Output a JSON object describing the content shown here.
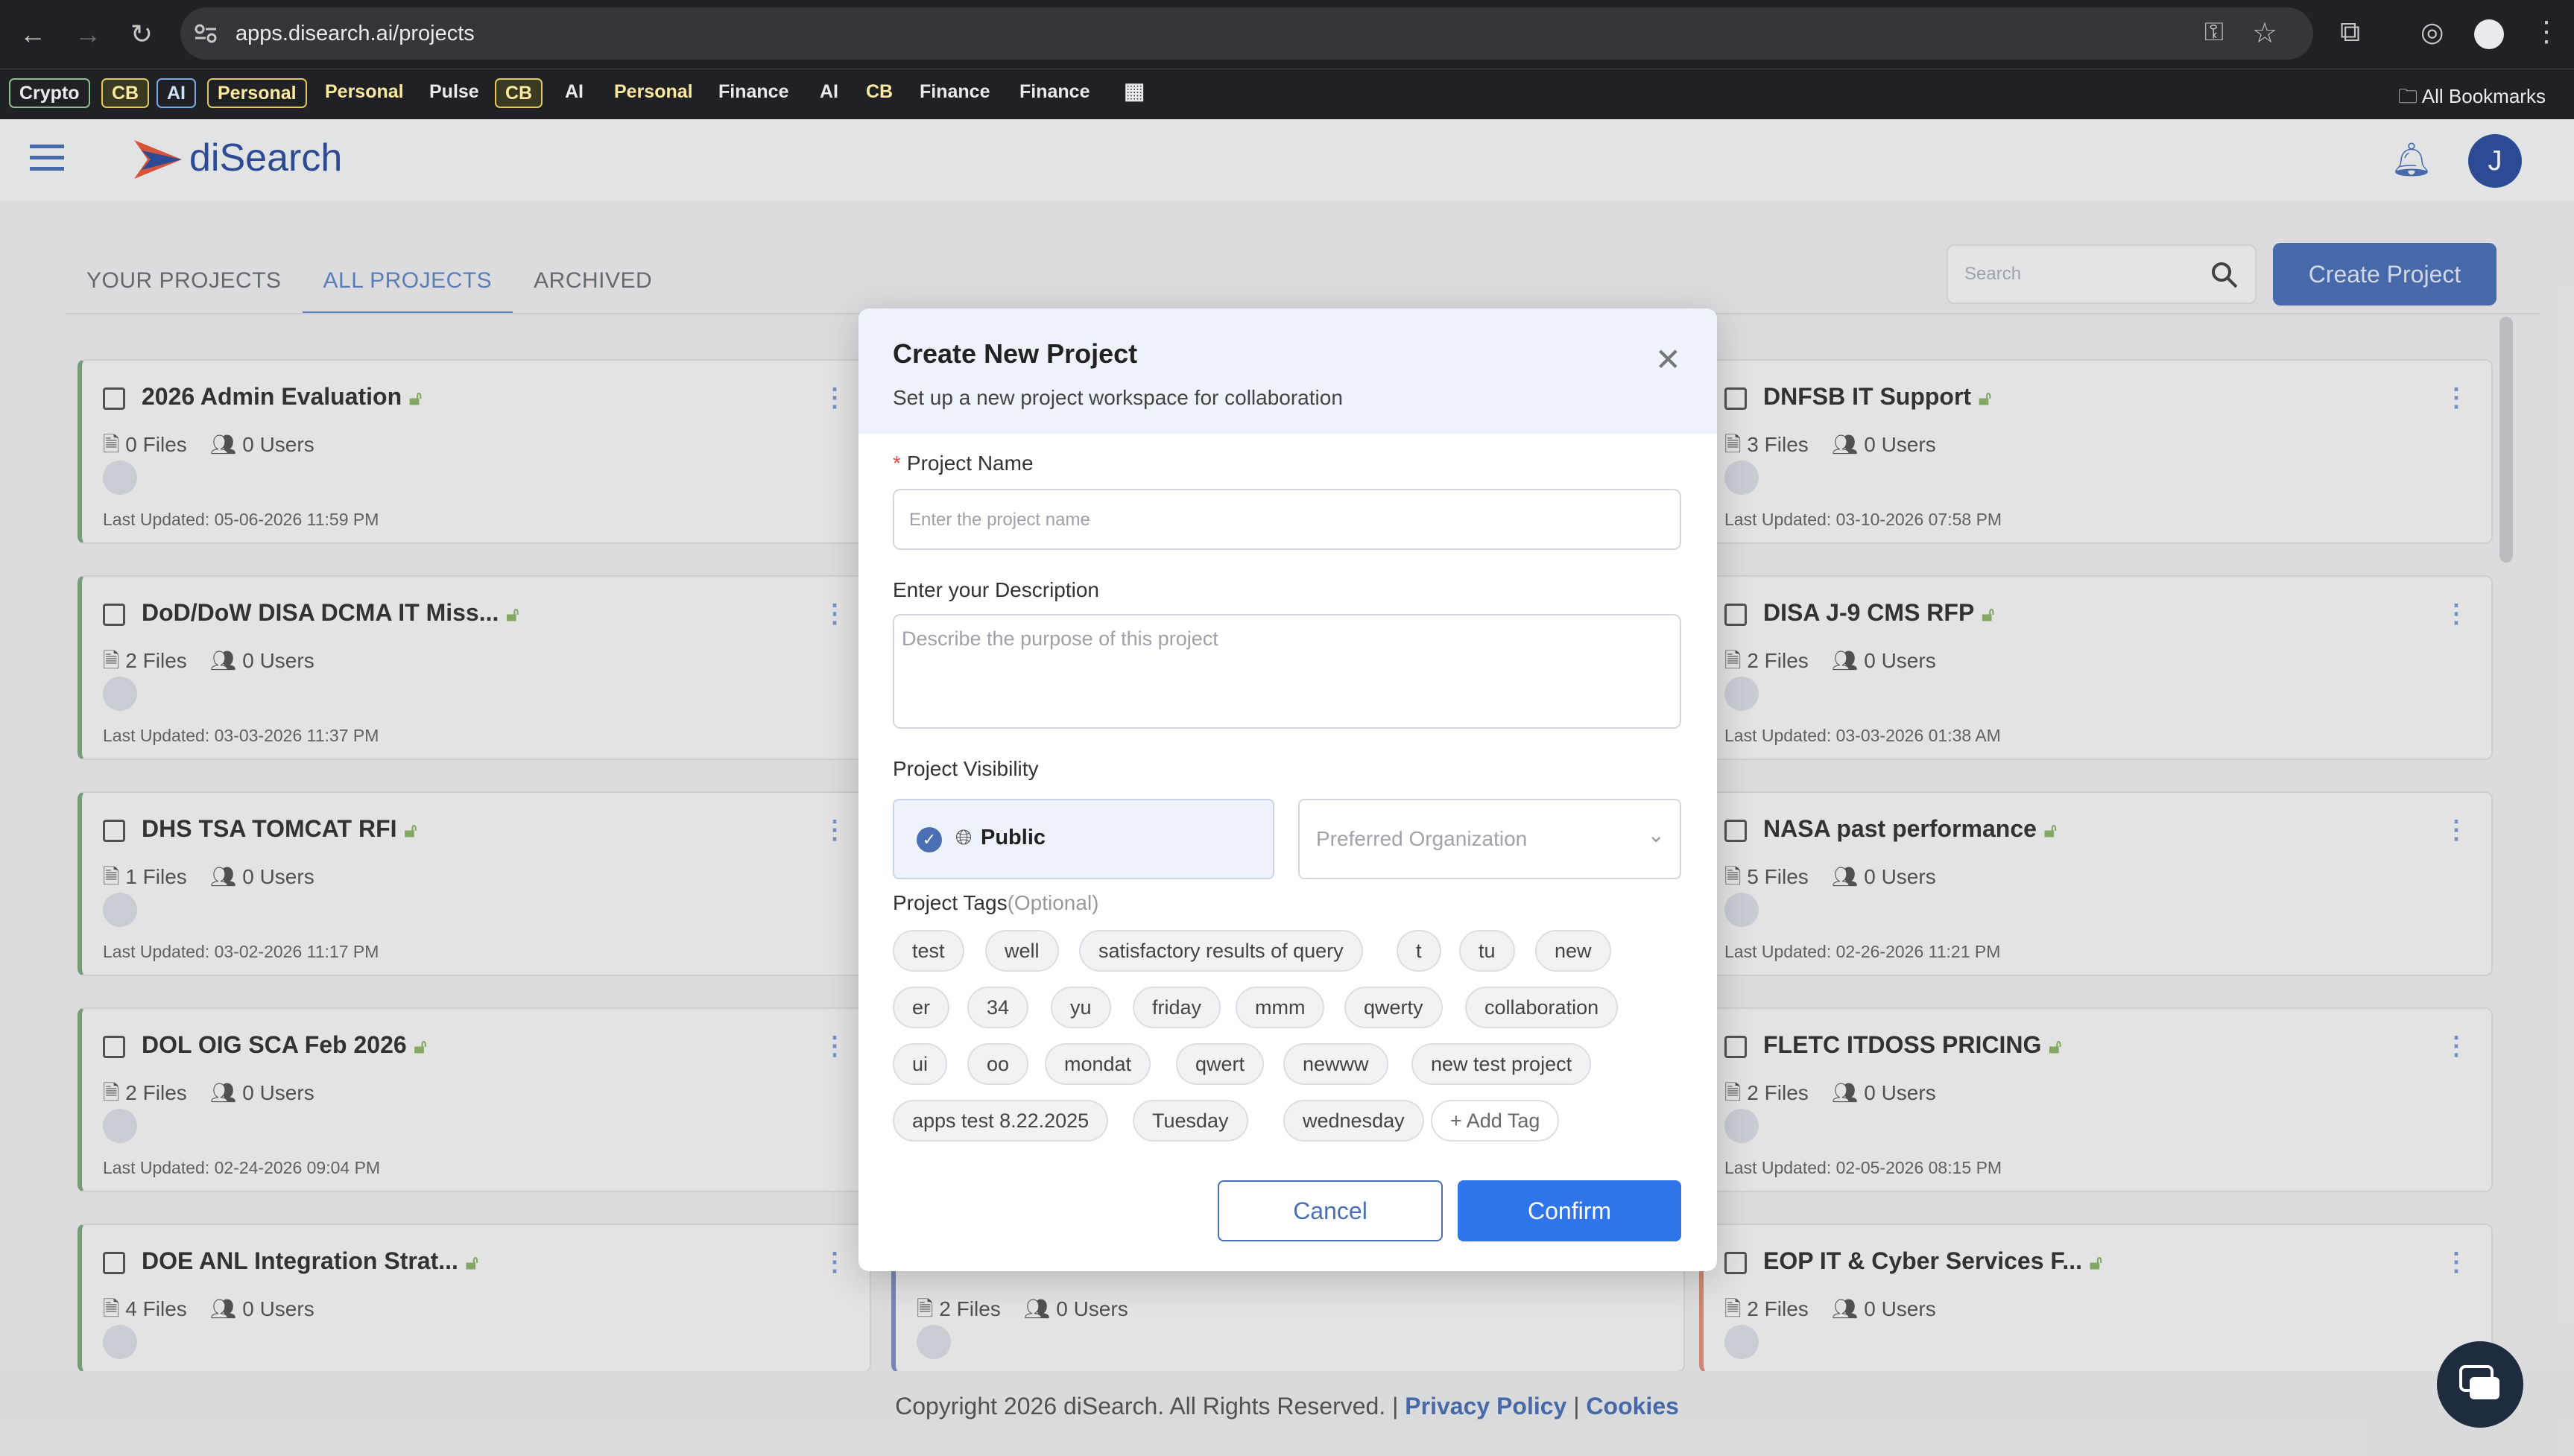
{
  "browser": {
    "url": "apps.disearch.ai/projects",
    "bookmarks": [
      "Crypto",
      "CB",
      "AI",
      "Personal",
      "Personal",
      "Pulse",
      "CB",
      "AI",
      "Personal",
      "Finance",
      "AI",
      "CB",
      "Finance",
      "Finance"
    ],
    "all_bookmarks": "All Bookmarks"
  },
  "header": {
    "brand": "diSearch",
    "avatar_letter": "J"
  },
  "tabs": [
    "YOUR PROJECTS",
    "ALL PROJECTS",
    "ARCHIVED"
  ],
  "search_placeholder": "Search",
  "create_project": "Create Project",
  "projects_left": [
    {
      "title": "2026 Admin Evaluation",
      "files": "0 Files",
      "users": "0 Users",
      "updated": "Last Updated: 05-06-2026 11:59 PM"
    },
    {
      "title": "DoD/DoW DISA DCMA IT Miss...",
      "files": "2 Files",
      "users": "0 Users",
      "updated": "Last Updated: 03-03-2026 11:37 PM"
    },
    {
      "title": "DHS TSA TOMCAT RFI",
      "files": "1 Files",
      "users": "0 Users",
      "updated": "Last Updated: 03-02-2026 11:17 PM"
    },
    {
      "title": "DOL OIG SCA Feb 2026",
      "files": "2 Files",
      "users": "0 Users",
      "updated": "Last Updated: 02-24-2026 09:04 PM"
    },
    {
      "title": "DOE ANL Integration Strat...",
      "files": "4 Files",
      "users": "0 Users",
      "updated": ""
    }
  ],
  "projects_right": [
    {
      "title": "DNFSB IT Support",
      "files": "3 Files",
      "users": "0 Users",
      "updated": "Last Updated: 03-10-2026 07:58 PM"
    },
    {
      "title": "DISA J-9 CMS RFP",
      "files": "2 Files",
      "users": "0 Users",
      "updated": "Last Updated: 03-03-2026 01:38 AM"
    },
    {
      "title": "NASA past performance",
      "files": "5 Files",
      "users": "0 Users",
      "updated": "Last Updated: 02-26-2026 11:21 PM"
    },
    {
      "title": "FLETC ITDOSS PRICING",
      "files": "2 Files",
      "users": "0 Users",
      "updated": "Last Updated: 02-05-2026 08:15 PM"
    },
    {
      "title": "EOP IT & Cyber Services F...",
      "files": "2 Files",
      "users": "0 Users",
      "updated": ""
    }
  ],
  "projects_middle_partial": {
    "files": "2 Files",
    "users": "0 Users"
  },
  "modal": {
    "title": "Create New Project",
    "subtitle": "Set up a new project workspace for collaboration",
    "name_label": "Project Name",
    "name_placeholder": "Enter the project name",
    "desc_label": "Enter your Description",
    "desc_placeholder": "Describe the purpose of this project",
    "visibility_label": "Project Visibility",
    "visibility_value": "Public",
    "org_placeholder": "Preferred Organization",
    "tags_label": "Project Tags",
    "tags_optional": "(Optional)",
    "tags": [
      "test",
      "well",
      "satisfactory results of query",
      "t",
      "tu",
      "new",
      "er",
      "34",
      "yu",
      "friday",
      "mmm",
      "qwerty",
      "collaboration",
      "ui",
      "oo",
      "mondat",
      "qwert",
      "newww",
      "new test project",
      "apps test 8.22.2025",
      "Tuesday",
      "wednesday"
    ],
    "add_tag": "+ Add Tag",
    "cancel": "Cancel",
    "confirm": "Confirm"
  },
  "footer": {
    "copyright": "Copyright 2026 diSearch. All Rights Reserved. |",
    "privacy": "Privacy Policy",
    "sep": "|",
    "cookies": "Cookies"
  }
}
